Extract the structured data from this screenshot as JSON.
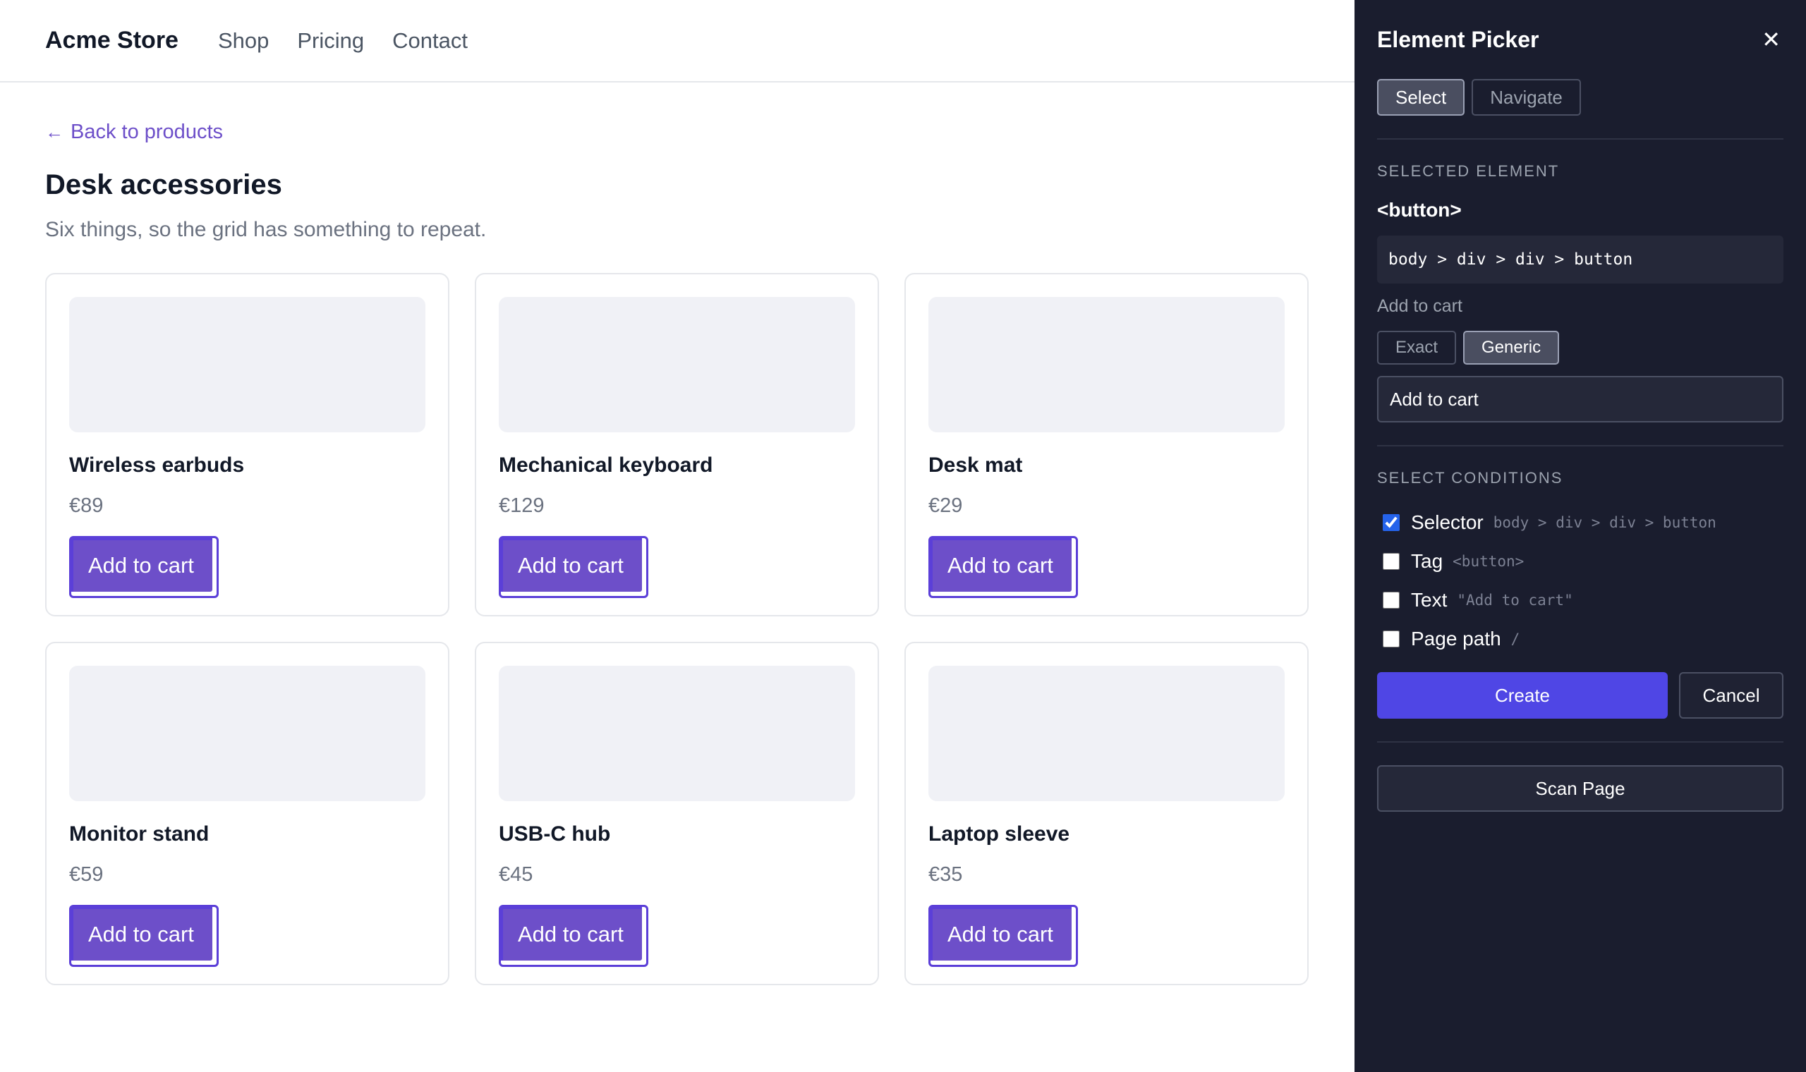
{
  "nav": {
    "brand": "Acme Store",
    "links": [
      "Shop",
      "Pricing",
      "Contact"
    ]
  },
  "page": {
    "back_link": "Back to products",
    "title": "Desk accessories",
    "subtitle": "Six things, so the grid has something to repeat."
  },
  "products": [
    {
      "name": "Wireless earbuds",
      "price": "€89",
      "button": "Add to cart"
    },
    {
      "name": "Mechanical keyboard",
      "price": "€129",
      "button": "Add to cart"
    },
    {
      "name": "Desk mat",
      "price": "€29",
      "button": "Add to cart"
    },
    {
      "name": "Monitor stand",
      "price": "€59",
      "button": "Add to cart"
    },
    {
      "name": "USB-C hub",
      "price": "€45",
      "button": "Add to cart"
    },
    {
      "name": "Laptop sleeve",
      "price": "€35",
      "button": "Add to cart"
    }
  ],
  "picker": {
    "title": "Element Picker",
    "close": "✕",
    "modes": [
      {
        "label": "Select",
        "active": true
      },
      {
        "label": "Navigate",
        "active": false
      }
    ],
    "selected_label": "SELECTED ELEMENT",
    "selected_tag": "<button>",
    "selector_path": "body > div > div > button",
    "selected_text": "Add to cart",
    "match_modes": [
      {
        "label": "Exact",
        "active": false
      },
      {
        "label": "Generic",
        "active": true
      }
    ],
    "text_value": "Add to cart",
    "conditions_label": "SELECT CONDITIONS",
    "conditions": [
      {
        "name": "Selector",
        "value": "body > div > div > button",
        "checked": true
      },
      {
        "name": "Tag",
        "value": "<button>",
        "checked": false
      },
      {
        "name": "Text",
        "value": "\"Add to cart\"",
        "checked": false
      },
      {
        "name": "Page path",
        "value": "/",
        "checked": false
      }
    ],
    "create_label": "Create",
    "cancel_label": "Cancel",
    "scan_label": "Scan Page"
  },
  "colors": {
    "accent": "#6d4fc9",
    "create": "#4f46e5",
    "panel_bg": "#1a1d2e"
  }
}
